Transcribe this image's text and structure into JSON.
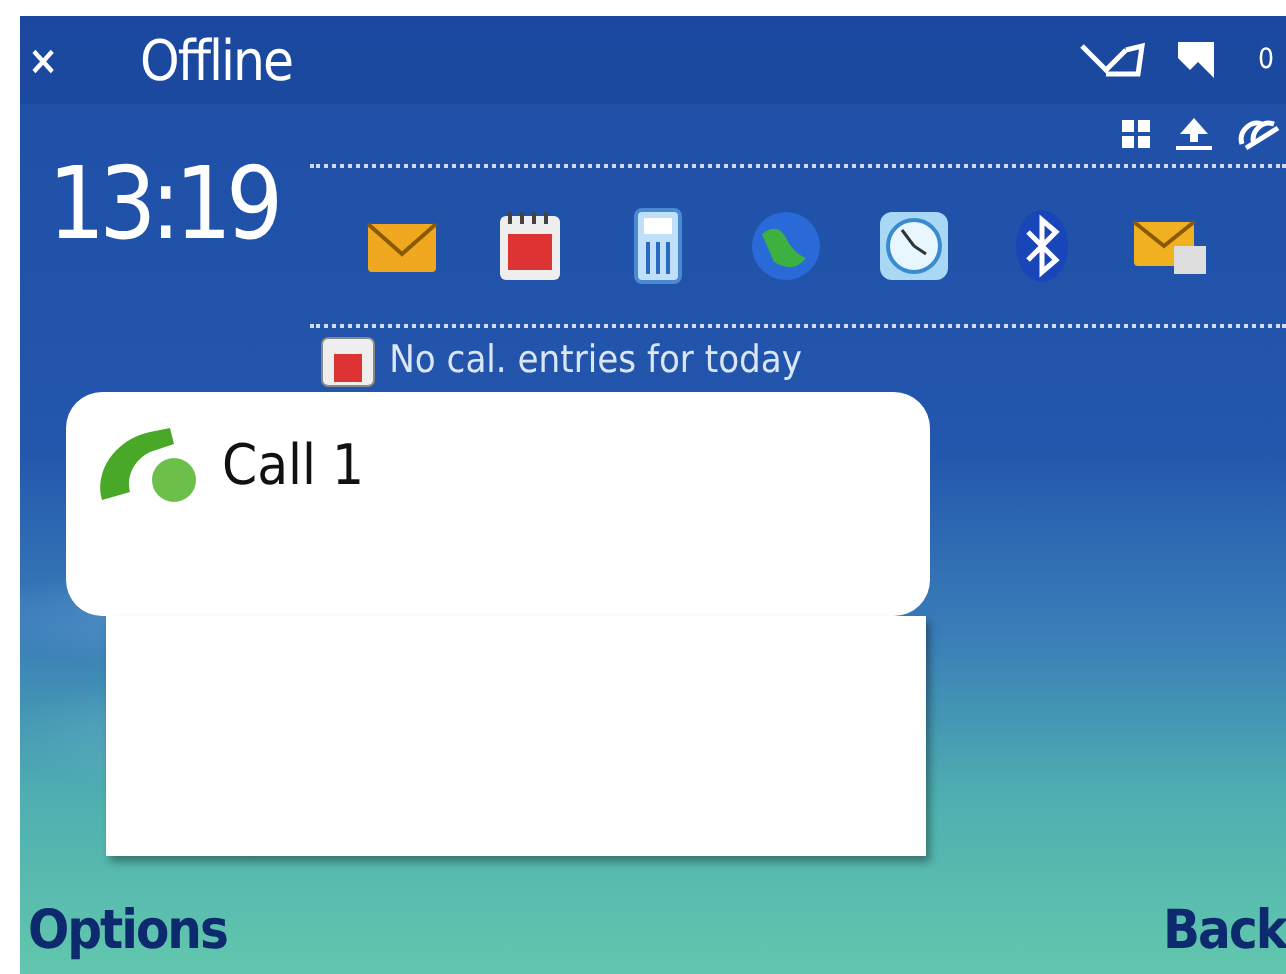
{
  "status_bar": {
    "close": "×",
    "profile": "Offline",
    "indicator": "0"
  },
  "clock": "13:19",
  "calendar": {
    "text": "No cal. entries for today"
  },
  "popup": {
    "title": "Call 1"
  },
  "softkeys": {
    "left": "Options",
    "right": "Back"
  }
}
